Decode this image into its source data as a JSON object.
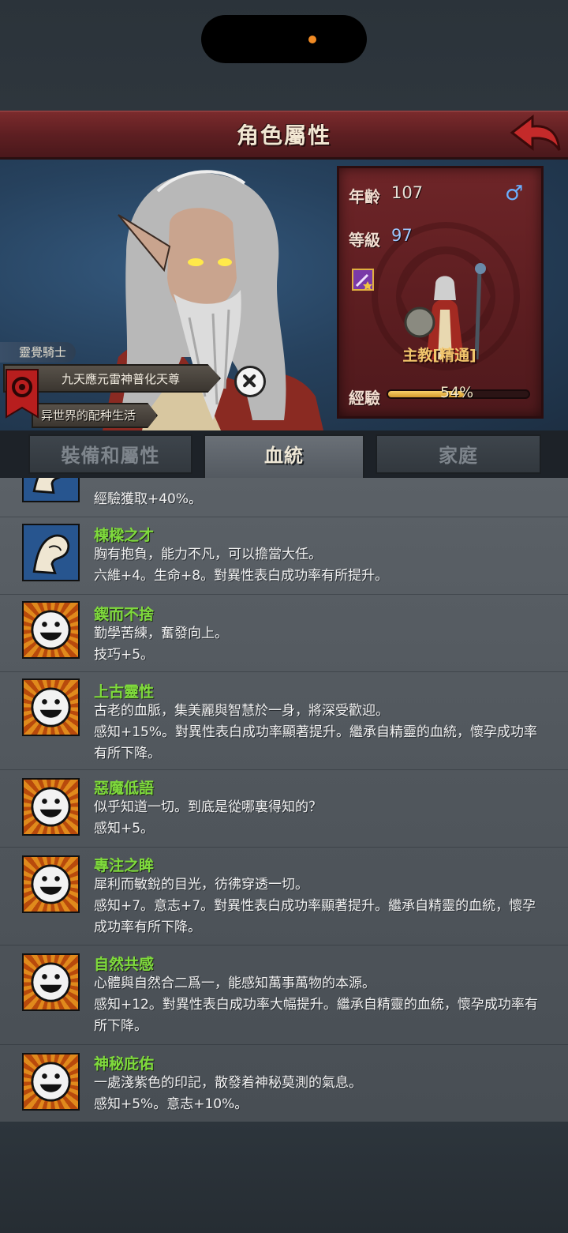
{
  "header": {
    "title": "角色屬性"
  },
  "character": {
    "class_label": "靈覺騎士",
    "title": "九天應元雷神普化天尊",
    "world": "异世界的配种生活",
    "age_label": "年齡",
    "age_value": "107",
    "gender_icon": "male-symbol",
    "gender_glyph": "♂",
    "level_label": "等級",
    "level_value": "97",
    "rank": "主教[精通]",
    "exp_label": "經驗",
    "exp_value": "54%",
    "exp_fraction": 0.54
  },
  "tabs": [
    {
      "label": "裝備和屬性",
      "active": false
    },
    {
      "label": "血統",
      "active": true
    },
    {
      "label": "家庭",
      "active": false
    }
  ],
  "colors": {
    "trait_name": "#7fda3c",
    "title_bar": "#6a2426",
    "stats_panel": "#5b1d20"
  },
  "traits": [
    {
      "icon": "arm-icon",
      "name": "",
      "desc": "",
      "effect": "經驗獲取+40%。"
    },
    {
      "icon": "arm-icon",
      "name": "棟樑之才",
      "desc": "胸有抱負，能力不凡，可以擔當大任。",
      "effect": "六維+4。生命+8。對異性表白成功率有所提升。"
    },
    {
      "icon": "smiley-sun-icon",
      "name": "鍥而不捨",
      "desc": "勤學苦練，奮發向上。",
      "effect": "技巧+5。"
    },
    {
      "icon": "smiley-sun-icon",
      "name": "上古靈性",
      "desc": "古老的血脈，集美麗與智慧於一身，將深受歡迎。",
      "effect": "感知+15%。對異性表白成功率顯著提升。繼承自精靈的血統，懷孕成功率有所下降。"
    },
    {
      "icon": "smiley-sun-icon",
      "name": "惡魔低語",
      "desc": "似乎知道一切。到底是從哪裏得知的？",
      "effect": "感知+5。"
    },
    {
      "icon": "smiley-sun-icon",
      "name": "專注之眸",
      "desc": "犀利而敏銳的目光，彷彿穿透一切。",
      "effect": "感知+7。意志+7。對異性表白成功率顯著提升。繼承自精靈的血統，懷孕成功率有所下降。"
    },
    {
      "icon": "smiley-sun-icon",
      "name": "自然共感",
      "desc": "心體與自然合二爲一，能感知萬事萬物的本源。",
      "effect": "感知+12。對異性表白成功率大幅提升。繼承自精靈的血統，懷孕成功率有所下降。"
    },
    {
      "icon": "smiley-sun-icon",
      "name": "神秘庇佑",
      "desc": "一處淺紫色的印記，散發着神秘莫測的氣息。",
      "effect": "感知+5%。意志+10%。"
    }
  ]
}
